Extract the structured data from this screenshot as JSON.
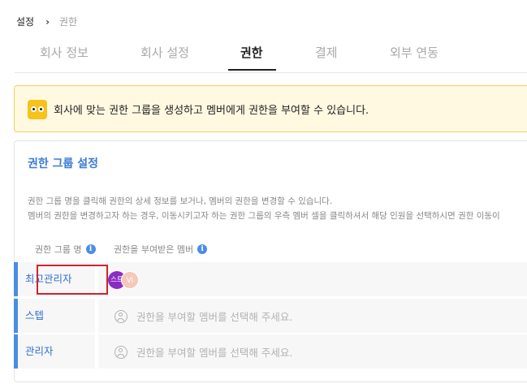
{
  "breadcrumb": {
    "home": "설정",
    "separator": "›",
    "current": "권한"
  },
  "tabs": [
    {
      "label": "회사 정보",
      "active": false
    },
    {
      "label": "회사 설정",
      "active": false
    },
    {
      "label": "권한",
      "active": true
    },
    {
      "label": "결제",
      "active": false
    },
    {
      "label": "외부 연동",
      "active": false
    }
  ],
  "notice": {
    "text": "회사에 맞는 권한 그룹을 생성하고 멤버에게 권한을 부여할 수 있습니다.",
    "icon": "eyes-icon",
    "bg_color": "#fff9e2",
    "border_color": "#f1cf5c"
  },
  "panel": {
    "title": "권한 그룹 설정",
    "desc_line1": "권한 그룹 명을 클릭해 권한의 상세 정보를 보거나, 멤버의 권한을 변경할 수 있습니다.",
    "desc_line2": "멤버의 권한을 변경하고자 하는 경우, 이동시키고자 하는 권한 그룹의 우측 멤버 셀을 클릭하셔서 해당 인원을 선택하시면 권한 이동이",
    "col_group": "권한 그룹 명",
    "col_members": "권한을 부여받은 멤버",
    "info_icon_glyph": "i"
  },
  "groups": [
    {
      "name": "최고관리자",
      "members": [
        {
          "initial": "스트",
          "color": "#8a2cc4"
        },
        {
          "initial": "VI",
          "color": "#f5c8b9"
        }
      ]
    },
    {
      "name": "스텝",
      "placeholder": "권한을 부여할 멤버를 선택해 주세요."
    },
    {
      "name": "관리자",
      "placeholder": "권한을 부여할 멤버를 선택해 주세요."
    }
  ],
  "colors": {
    "accent": "#4a8de4",
    "highlight": "#d2222d"
  }
}
